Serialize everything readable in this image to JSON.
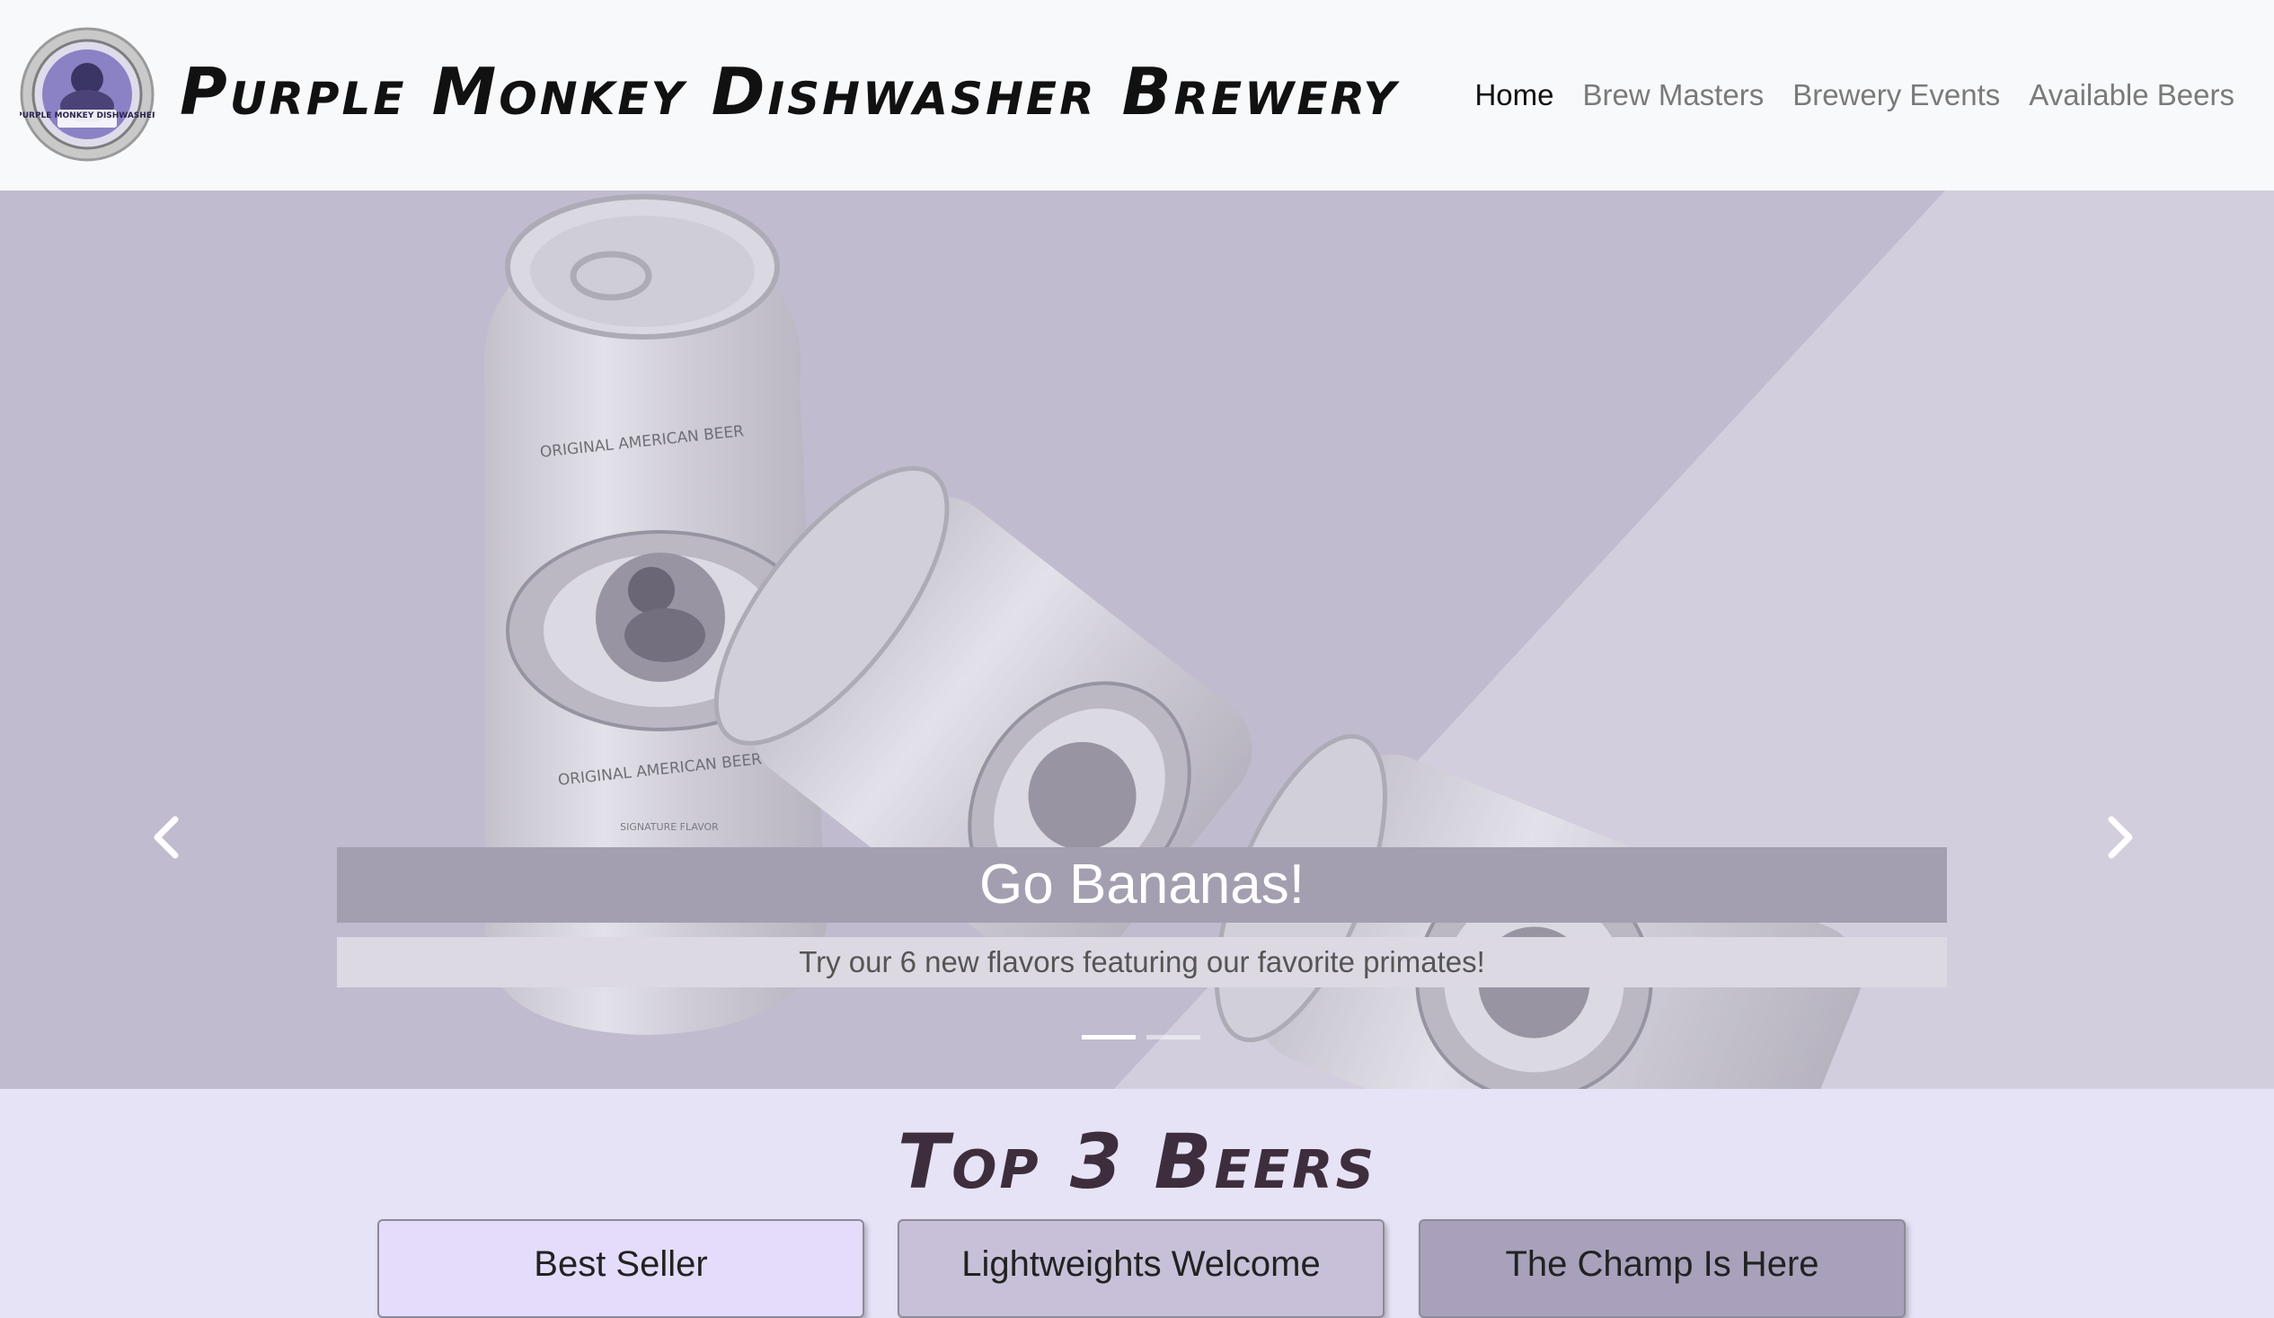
{
  "brand": {
    "name": "Purple Monkey Dishwasher Brewery",
    "logo_icon": "monkey-badge-logo",
    "logo_text": "PURPLE MONKEY DISHWASHER"
  },
  "nav": {
    "items": [
      {
        "label": "Home",
        "active": true
      },
      {
        "label": "Brew Masters",
        "active": false
      },
      {
        "label": "Brewery Events",
        "active": false
      },
      {
        "label": "Available Beers",
        "active": false
      }
    ]
  },
  "carousel": {
    "slide_image": "beer-cans-photo",
    "can_print": "ORIGINAL AMERICAN BEER",
    "can_flavor": "SIGNATURE FLAVOR",
    "caption_title": "Go Bananas!",
    "caption_text": "Try our 6 new flavors featuring our favorite primates!",
    "prev_icon": "chevron-left-icon",
    "next_icon": "chevron-right-icon",
    "slide_count": 2,
    "active_slide": 1
  },
  "top_beers": {
    "title": "Top 3 Beers",
    "cards": [
      {
        "title": "Best Seller",
        "color": "#e4dcfa"
      },
      {
        "title": "Lightweights Welcome",
        "color": "#c7c0d8"
      },
      {
        "title": "The Champ Is Here",
        "color": "#a9a1bb"
      }
    ]
  },
  "colors": {
    "navbar_bg": "#f8f9fa",
    "page_bg": "#e6e3f7",
    "hero_bg": "#c4bfd0",
    "caption_title_bg": "#a39fb0",
    "caption_text_bg": "#dcd9e3",
    "heading": "#3e2e3d"
  }
}
